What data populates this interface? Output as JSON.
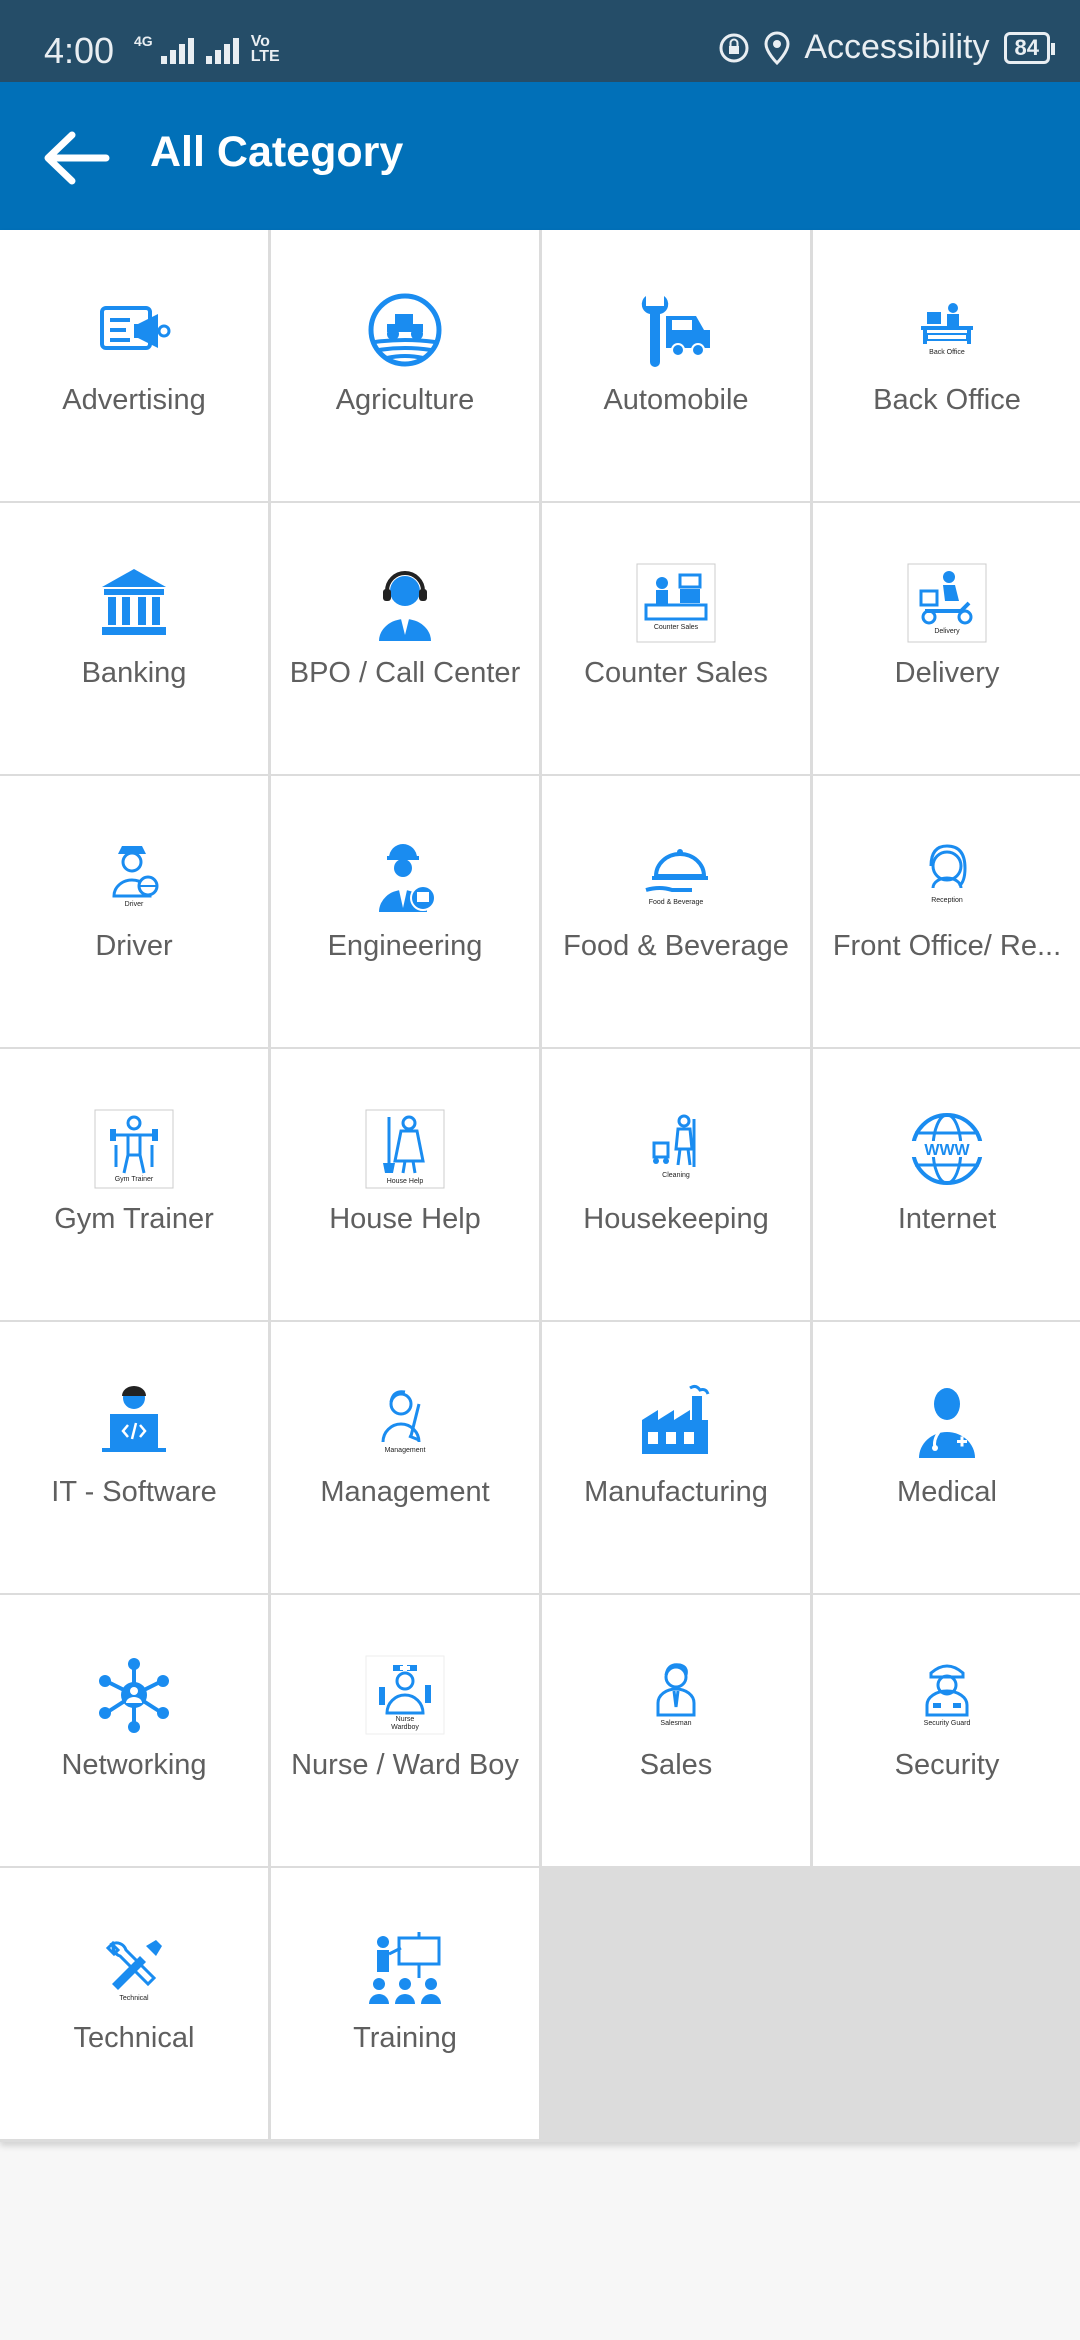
{
  "status_bar": {
    "time": "4:00",
    "network_tag": "4G",
    "volte": "Vo LTE",
    "accessibility": "Accessibility",
    "battery": "84"
  },
  "app_bar": {
    "title": "All Category",
    "back_icon": "arrow-left-icon"
  },
  "colors": {
    "primary": "#0170b8",
    "status_bar": "#254d68",
    "icon_blue": "#1a8cf0",
    "label_gray": "#5f5f5f"
  },
  "categories": [
    {
      "label": "Advertising",
      "icon": "advertising-icon"
    },
    {
      "label": "Agriculture",
      "icon": "tractor-icon"
    },
    {
      "label": "Automobile",
      "icon": "car-wrench-icon"
    },
    {
      "label": "Back Office",
      "icon": "back-office-icon",
      "icon_caption": "Back Office"
    },
    {
      "label": "Banking",
      "icon": "bank-icon"
    },
    {
      "label": "BPO / Call Center",
      "icon": "headset-agent-icon"
    },
    {
      "label": "Counter Sales",
      "icon": "counter-sales-icon",
      "icon_caption": "Counter Sales"
    },
    {
      "label": "Delivery",
      "icon": "delivery-scooter-icon",
      "icon_caption": "Delivery"
    },
    {
      "label": "Driver",
      "icon": "driver-icon",
      "icon_caption": "Driver"
    },
    {
      "label": "Engineering",
      "icon": "engineer-icon"
    },
    {
      "label": "Food & Beverage",
      "icon": "cloche-icon",
      "icon_caption": "Food & Beverage"
    },
    {
      "label": "Front Office/ Re...",
      "icon": "receptionist-icon",
      "icon_caption": "Reception"
    },
    {
      "label": "Gym Trainer",
      "icon": "gym-trainer-icon",
      "icon_caption": "Gym Trainer"
    },
    {
      "label": "House Help",
      "icon": "house-help-icon",
      "icon_caption": "House Help"
    },
    {
      "label": "Housekeeping",
      "icon": "cleaning-icon",
      "icon_caption": "Cleaning"
    },
    {
      "label": "Internet",
      "icon": "globe-www-icon"
    },
    {
      "label": "IT - Software",
      "icon": "developer-laptop-icon"
    },
    {
      "label": "Management",
      "icon": "manager-icon",
      "icon_caption": "Management"
    },
    {
      "label": "Manufacturing",
      "icon": "factory-icon"
    },
    {
      "label": "Medical",
      "icon": "doctor-icon"
    },
    {
      "label": "Networking",
      "icon": "network-nodes-icon"
    },
    {
      "label": "Nurse / Ward Boy",
      "icon": "nurse-icon",
      "icon_caption": "Nurse Wardboy"
    },
    {
      "label": "Sales",
      "icon": "salesman-icon",
      "icon_caption": "Salesman"
    },
    {
      "label": "Security",
      "icon": "security-guard-icon",
      "icon_caption": "Security Guard"
    },
    {
      "label": "Technical",
      "icon": "tools-icon",
      "icon_caption": "Technical"
    },
    {
      "label": "Training",
      "icon": "trainer-board-icon"
    }
  ]
}
